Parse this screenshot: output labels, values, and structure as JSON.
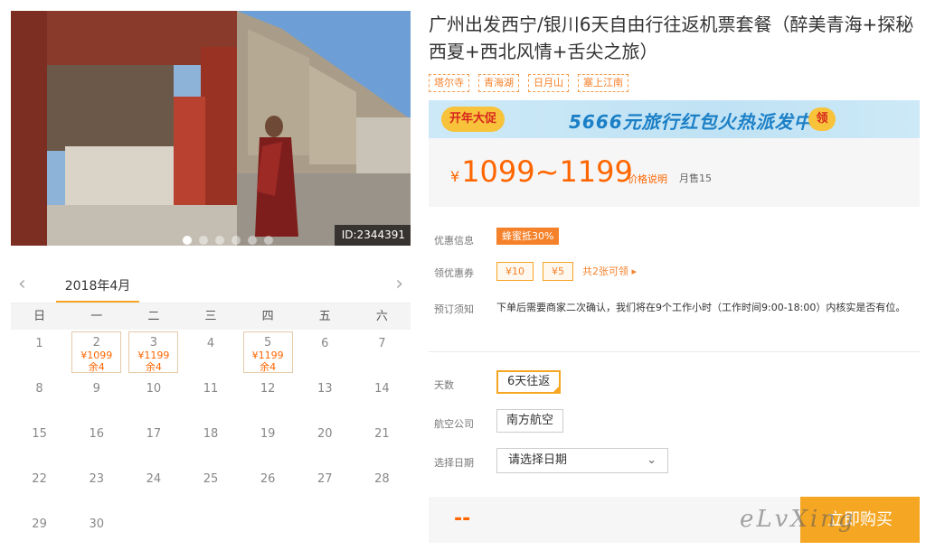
{
  "photo": {
    "id_label": "ID:2344391",
    "slides": [
      true,
      false,
      false,
      false,
      false,
      false
    ]
  },
  "calendar": {
    "prev_arrow": "‹",
    "next_arrow": "›",
    "month": "2018年4月",
    "weekdays": [
      "日",
      "一",
      "二",
      "三",
      "四",
      "五",
      "六"
    ],
    "days": [
      {
        "day": "1"
      },
      {
        "day": "2",
        "price": "¥1099",
        "remain": "余4"
      },
      {
        "day": "3",
        "price": "¥1199",
        "remain": "余4"
      },
      {
        "day": "4"
      },
      {
        "day": "5",
        "price": "¥1199",
        "remain": "余4"
      },
      {
        "day": "6"
      },
      {
        "day": "7"
      },
      {
        "day": "8"
      },
      {
        "day": "9"
      },
      {
        "day": "10"
      },
      {
        "day": "11"
      },
      {
        "day": "12"
      },
      {
        "day": "13"
      },
      {
        "day": "14"
      },
      {
        "day": "15"
      },
      {
        "day": "16"
      },
      {
        "day": "17"
      },
      {
        "day": "18"
      },
      {
        "day": "19"
      },
      {
        "day": "20"
      },
      {
        "day": "21"
      },
      {
        "day": "22"
      },
      {
        "day": "23"
      },
      {
        "day": "24"
      },
      {
        "day": "25"
      },
      {
        "day": "26"
      },
      {
        "day": "27"
      },
      {
        "day": "28"
      },
      {
        "day": "29"
      },
      {
        "day": "30"
      }
    ]
  },
  "product": {
    "title": "广州出发西宁/银川6天自由行往返机票套餐（醉美青海+探秘西夏+西北风情+舌尖之旅）",
    "tags": [
      "塔尔寺",
      "青海湖",
      "日月山",
      "塞上江南"
    ]
  },
  "promo": {
    "badge": "开年大促",
    "text": "5666元旅行红包火热派发中",
    "button": "领"
  },
  "price": {
    "currency": "¥",
    "range": "1099~1199",
    "note": "价格说明",
    "monthly_sales": "月售15"
  },
  "info": {
    "discount_label": "优惠信息",
    "discount_badge": "蜂蜜抵30%",
    "coupon_label": "领优惠券",
    "coupons": [
      "¥10",
      "¥5"
    ],
    "coupon_more": "共2张可领 ▸",
    "notice_label": "预订须知",
    "notice_text": "下单后需要商家二次确认，我们将在9个工作小时（工作时间9:00-18:00）内核实是否有位。"
  },
  "options": {
    "days_label": "天数",
    "days_value": "6天往返",
    "airline_label": "航空公司",
    "airline_value": "南方航空",
    "date_label": "选择日期",
    "date_placeholder": "请选择日期"
  },
  "buy": {
    "price_placeholder": "--",
    "button": "立即购买"
  },
  "watermark": "eLvXing"
}
